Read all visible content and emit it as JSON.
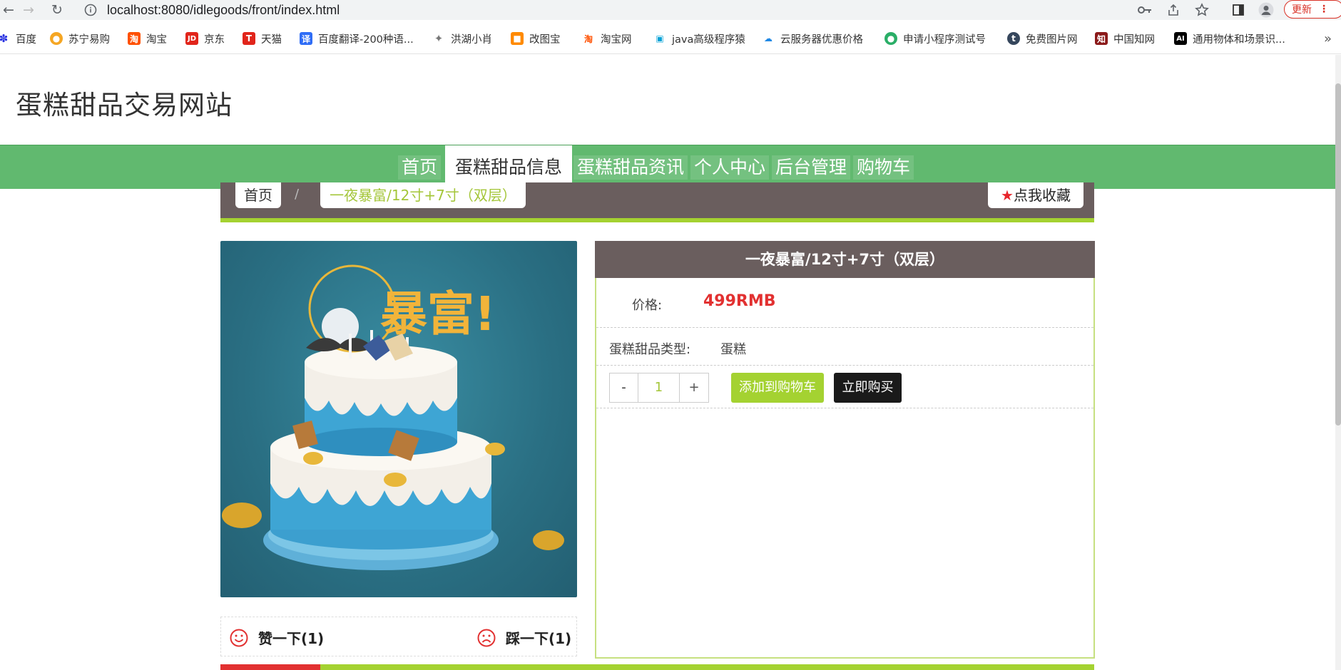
{
  "browser": {
    "url": "localhost:8080/idlegoods/front/index.html",
    "update_label": "更新"
  },
  "bookmarks": [
    {
      "label": "百度",
      "icon": "baidu-icon",
      "color": "#2932e1"
    },
    {
      "label": "苏宁易购",
      "icon": "suning-icon",
      "color": "#f5a623"
    },
    {
      "label": "淘宝",
      "icon": "taobao-icon",
      "color": "#ff5000"
    },
    {
      "label": "京东",
      "icon": "jd-icon",
      "color": "#e1251b"
    },
    {
      "label": "天猫",
      "icon": "tmall-icon",
      "color": "#e1251b"
    },
    {
      "label": "百度翻译-200种语...",
      "icon": "translate-icon",
      "color": "#2f6df6"
    },
    {
      "label": "洪湖小肖",
      "icon": "bird-icon",
      "color": "#777"
    },
    {
      "label": "改图宝",
      "icon": "gaitubao-icon",
      "color": "#ff8a00"
    },
    {
      "label": "淘宝网",
      "icon": "taobao-icon",
      "color": "#ff5000"
    },
    {
      "label": "java高级程序猿",
      "icon": "bilibili-icon",
      "color": "#00a1d6"
    },
    {
      "label": "云服务器优惠价格",
      "icon": "cloud-icon",
      "color": "#1e88e5"
    },
    {
      "label": "申请小程序测试号",
      "icon": "wechat-icon",
      "color": "#2aae67"
    },
    {
      "label": "免费图片网",
      "icon": "tumblr-icon",
      "color": "#35465c"
    },
    {
      "label": "中国知网",
      "icon": "cnki-icon",
      "color": "#8b1a1a"
    },
    {
      "label": "通用物体和场景识...",
      "icon": "ai-icon",
      "color": "#000000"
    }
  ],
  "site": {
    "title": "蛋糕甜品交易网站"
  },
  "nav": {
    "items": [
      "首页",
      "蛋糕甜品信息",
      "蛋糕甜品资讯",
      "个人中心",
      "后台管理",
      "购物车"
    ],
    "active": "蛋糕甜品信息"
  },
  "breadcrumb": {
    "home": "首页",
    "separator": "/",
    "current": "一夜暴富/12寸+7寸（双层）"
  },
  "favorite_label": "点我收藏",
  "product": {
    "name": "一夜暴富/12寸+7寸（双层）",
    "price_label": "价格:",
    "price": "499RMB",
    "type_label": "蛋糕甜品类型:",
    "type": "蛋糕",
    "quantity": "1",
    "minus": "-",
    "plus": "+",
    "add_to_cart": "添加到购物车",
    "buy_now": "立即购买"
  },
  "votes": {
    "like": "赞一下(1)",
    "dislike": "踩一下(1)"
  },
  "colors": {
    "nav_green": "#61b96f",
    "accent_lime": "#a4d231",
    "header_brown": "#6a5e5e",
    "price_red": "#e23131"
  }
}
